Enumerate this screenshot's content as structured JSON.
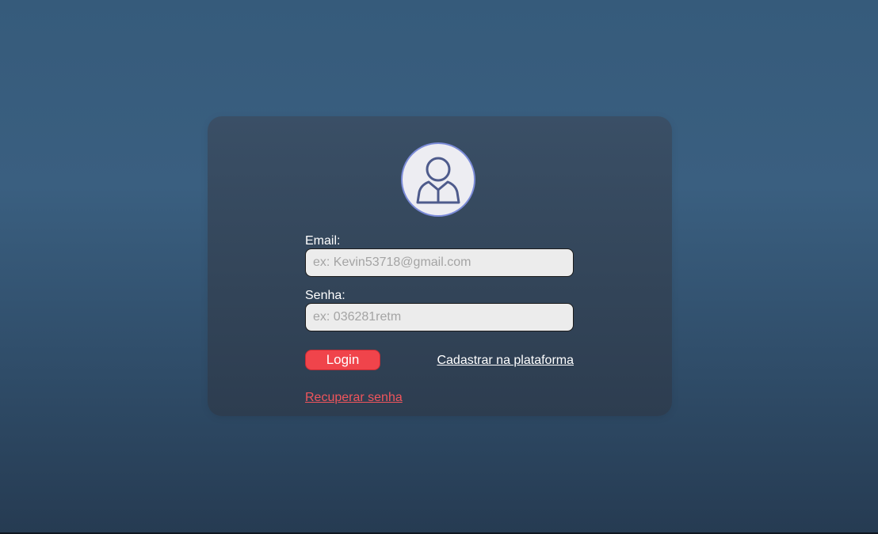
{
  "login_form": {
    "email": {
      "label": "Email:",
      "placeholder": "ex: Kevin53718@gmail.com",
      "value": ""
    },
    "password": {
      "label": "Senha:",
      "placeholder": "ex: 036281retm",
      "value": ""
    },
    "login_button_label": "Login",
    "register_link_label": "Cadastrar na plataforma",
    "recover_link_label": "Recuperar senha",
    "avatar_icon": "user-icon"
  },
  "colors": {
    "accent": "#f0444b",
    "avatar_ring": "#7b8bd8",
    "icon": "#4e5b8c",
    "field_bg": "#ececec"
  }
}
